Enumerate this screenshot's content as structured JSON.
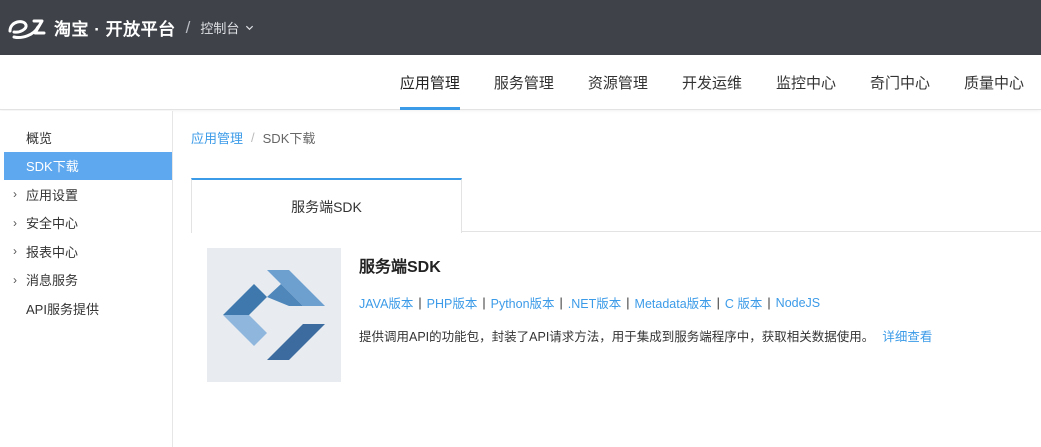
{
  "header": {
    "brand": "淘宝 · 开放平台",
    "slash": "/",
    "console_label": "控制台"
  },
  "nav": {
    "items": [
      "应用管理",
      "服务管理",
      "资源管理",
      "开发运维",
      "监控中心",
      "奇门中心",
      "质量中心"
    ],
    "active_index": 0
  },
  "sidebar": {
    "items": [
      {
        "label": "概览",
        "expandable": false
      },
      {
        "label": "SDK下载",
        "expandable": false,
        "active": true
      },
      {
        "label": "应用设置",
        "expandable": true
      },
      {
        "label": "安全中心",
        "expandable": true
      },
      {
        "label": "报表中心",
        "expandable": true
      },
      {
        "label": "消息服务",
        "expandable": true
      },
      {
        "label": "API服务提供",
        "expandable": false
      }
    ]
  },
  "breadcrumb": {
    "parent": "应用管理",
    "separator": "/",
    "current": "SDK下载"
  },
  "tabs": [
    {
      "label": "服务端SDK",
      "active": true
    }
  ],
  "sdk": {
    "title": "服务端SDK",
    "links": [
      "JAVA版本",
      "PHP版本",
      "Python版本",
      ".NET版本",
      "Metadata版本",
      "C 版本",
      "NodeJS"
    ],
    "link_separator": "|",
    "description": "提供调用API的功能包，封装了API请求方法，用于集成到服务端程序中，获取相关数据使用。",
    "detail_link": "详细查看"
  },
  "colors": {
    "topbar_bg": "#3f4249",
    "accent": "#3c9be8",
    "sidebar_active": "#5ea8ef"
  }
}
